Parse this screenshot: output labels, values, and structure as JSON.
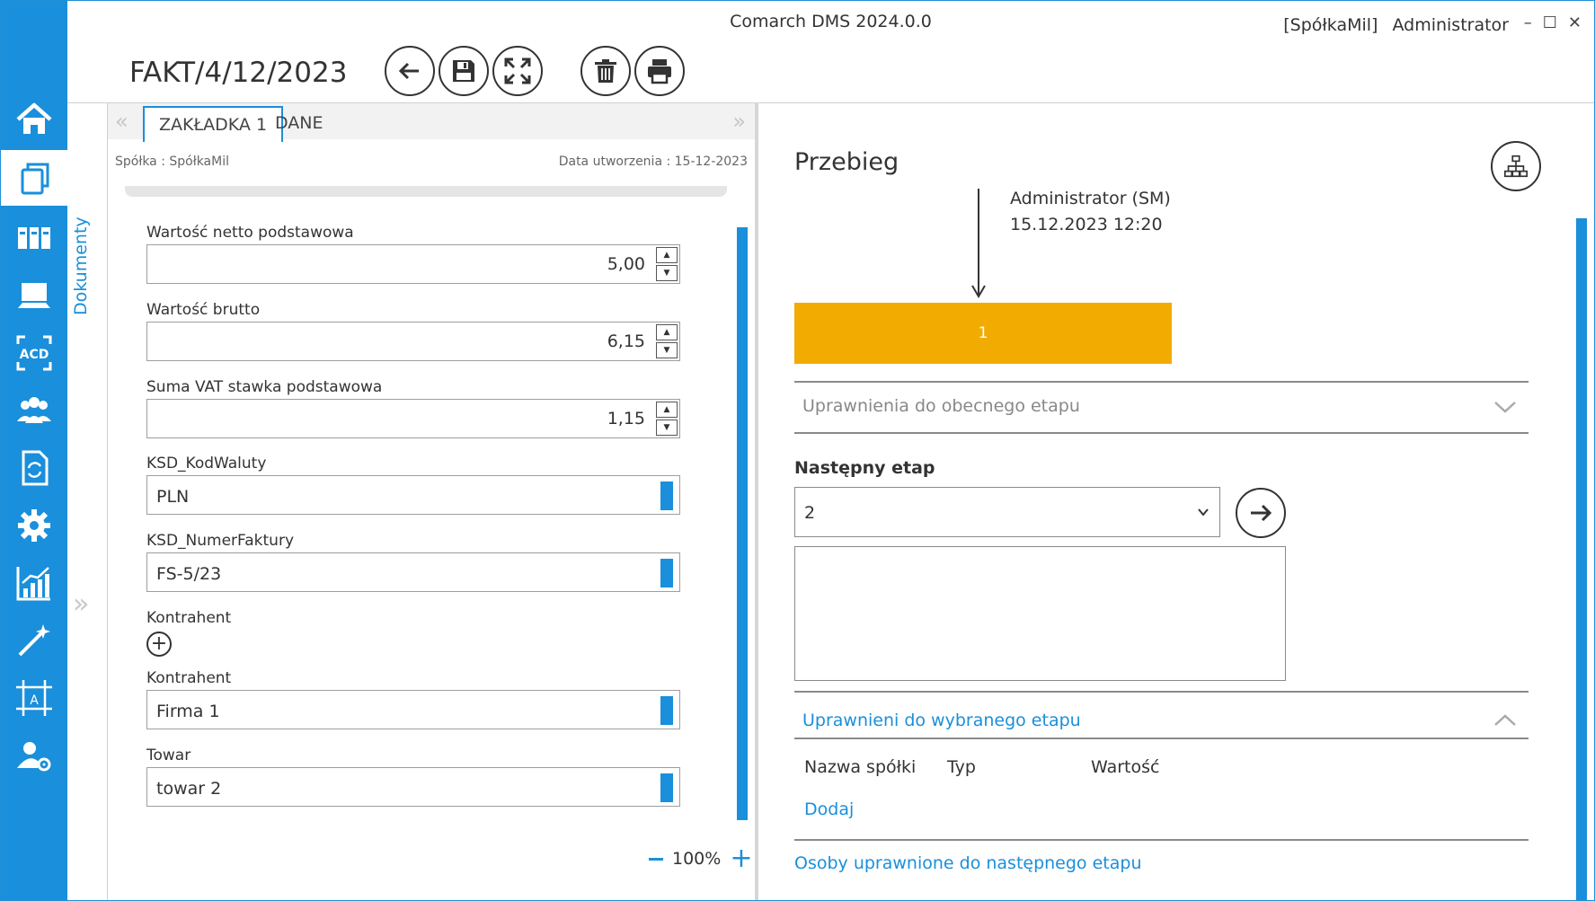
{
  "app": {
    "title": "Comarch DMS 2024.0.0",
    "company": "[SpółkaMil]",
    "user": "Administrator",
    "window_controls": [
      "–",
      "☐",
      "✕"
    ]
  },
  "document": {
    "title": "FAKT/4/12/2023"
  },
  "sidebar": {
    "items": [
      {
        "name": "home-icon"
      },
      {
        "name": "documents-icon",
        "active": true
      },
      {
        "name": "repository-icon"
      },
      {
        "name": "workstation-icon"
      },
      {
        "name": "ocr-acd-icon"
      },
      {
        "name": "users-icon"
      },
      {
        "name": "document-exchange-icon"
      },
      {
        "name": "settings-icon"
      },
      {
        "name": "reports-icon"
      },
      {
        "name": "magic-wand-icon"
      },
      {
        "name": "template-designer-icon"
      },
      {
        "name": "user-settings-icon"
      }
    ]
  },
  "left_strip": {
    "label": "Dokumenty"
  },
  "tabs": [
    {
      "label": "ZAKŁADKA 1",
      "active": true
    },
    {
      "label": "DANE",
      "active": false
    }
  ],
  "meta": {
    "company": "Spółka : SpółkaMil",
    "created": "Data utworzenia : 15-12-2023"
  },
  "fields": {
    "netto": {
      "label": "Wartość netto podstawowa",
      "value": "5,00"
    },
    "brutto": {
      "label": "Wartość brutto",
      "value": "6,15"
    },
    "vat": {
      "label": "Suma VAT stawka podstawowa",
      "value": "1,15"
    },
    "waluta": {
      "label": "KSD_KodWaluty",
      "value": "PLN"
    },
    "numer": {
      "label": "KSD_NumerFaktury",
      "value": "FS-5/23"
    },
    "kontrahent_add": {
      "label": "Kontrahent"
    },
    "kontrahent": {
      "label": "Kontrahent",
      "value": "Firma 1"
    },
    "towar": {
      "label": "Towar",
      "value": "towar 2"
    }
  },
  "zoom": {
    "value": "100%"
  },
  "flow": {
    "title": "Przebieg",
    "user": "Administrator (SM)",
    "date": "15.12.2023 12:20",
    "stage": "1",
    "stage_color": "#f2ab00",
    "permissions_current": "Uprawnienia do obecnego etapu",
    "next_label": "Następny etap",
    "next_value": "2",
    "permitted_selected": "Uprawnieni do wybranego etapu",
    "table_headers": [
      "Nazwa spółki",
      "Typ",
      "Wartość"
    ],
    "add_link": "Dodaj",
    "next_persons": "Osoby uprawnione do następnego etapu"
  },
  "colors": {
    "accent": "#1a8fdb",
    "stage": "#f2ab00"
  }
}
